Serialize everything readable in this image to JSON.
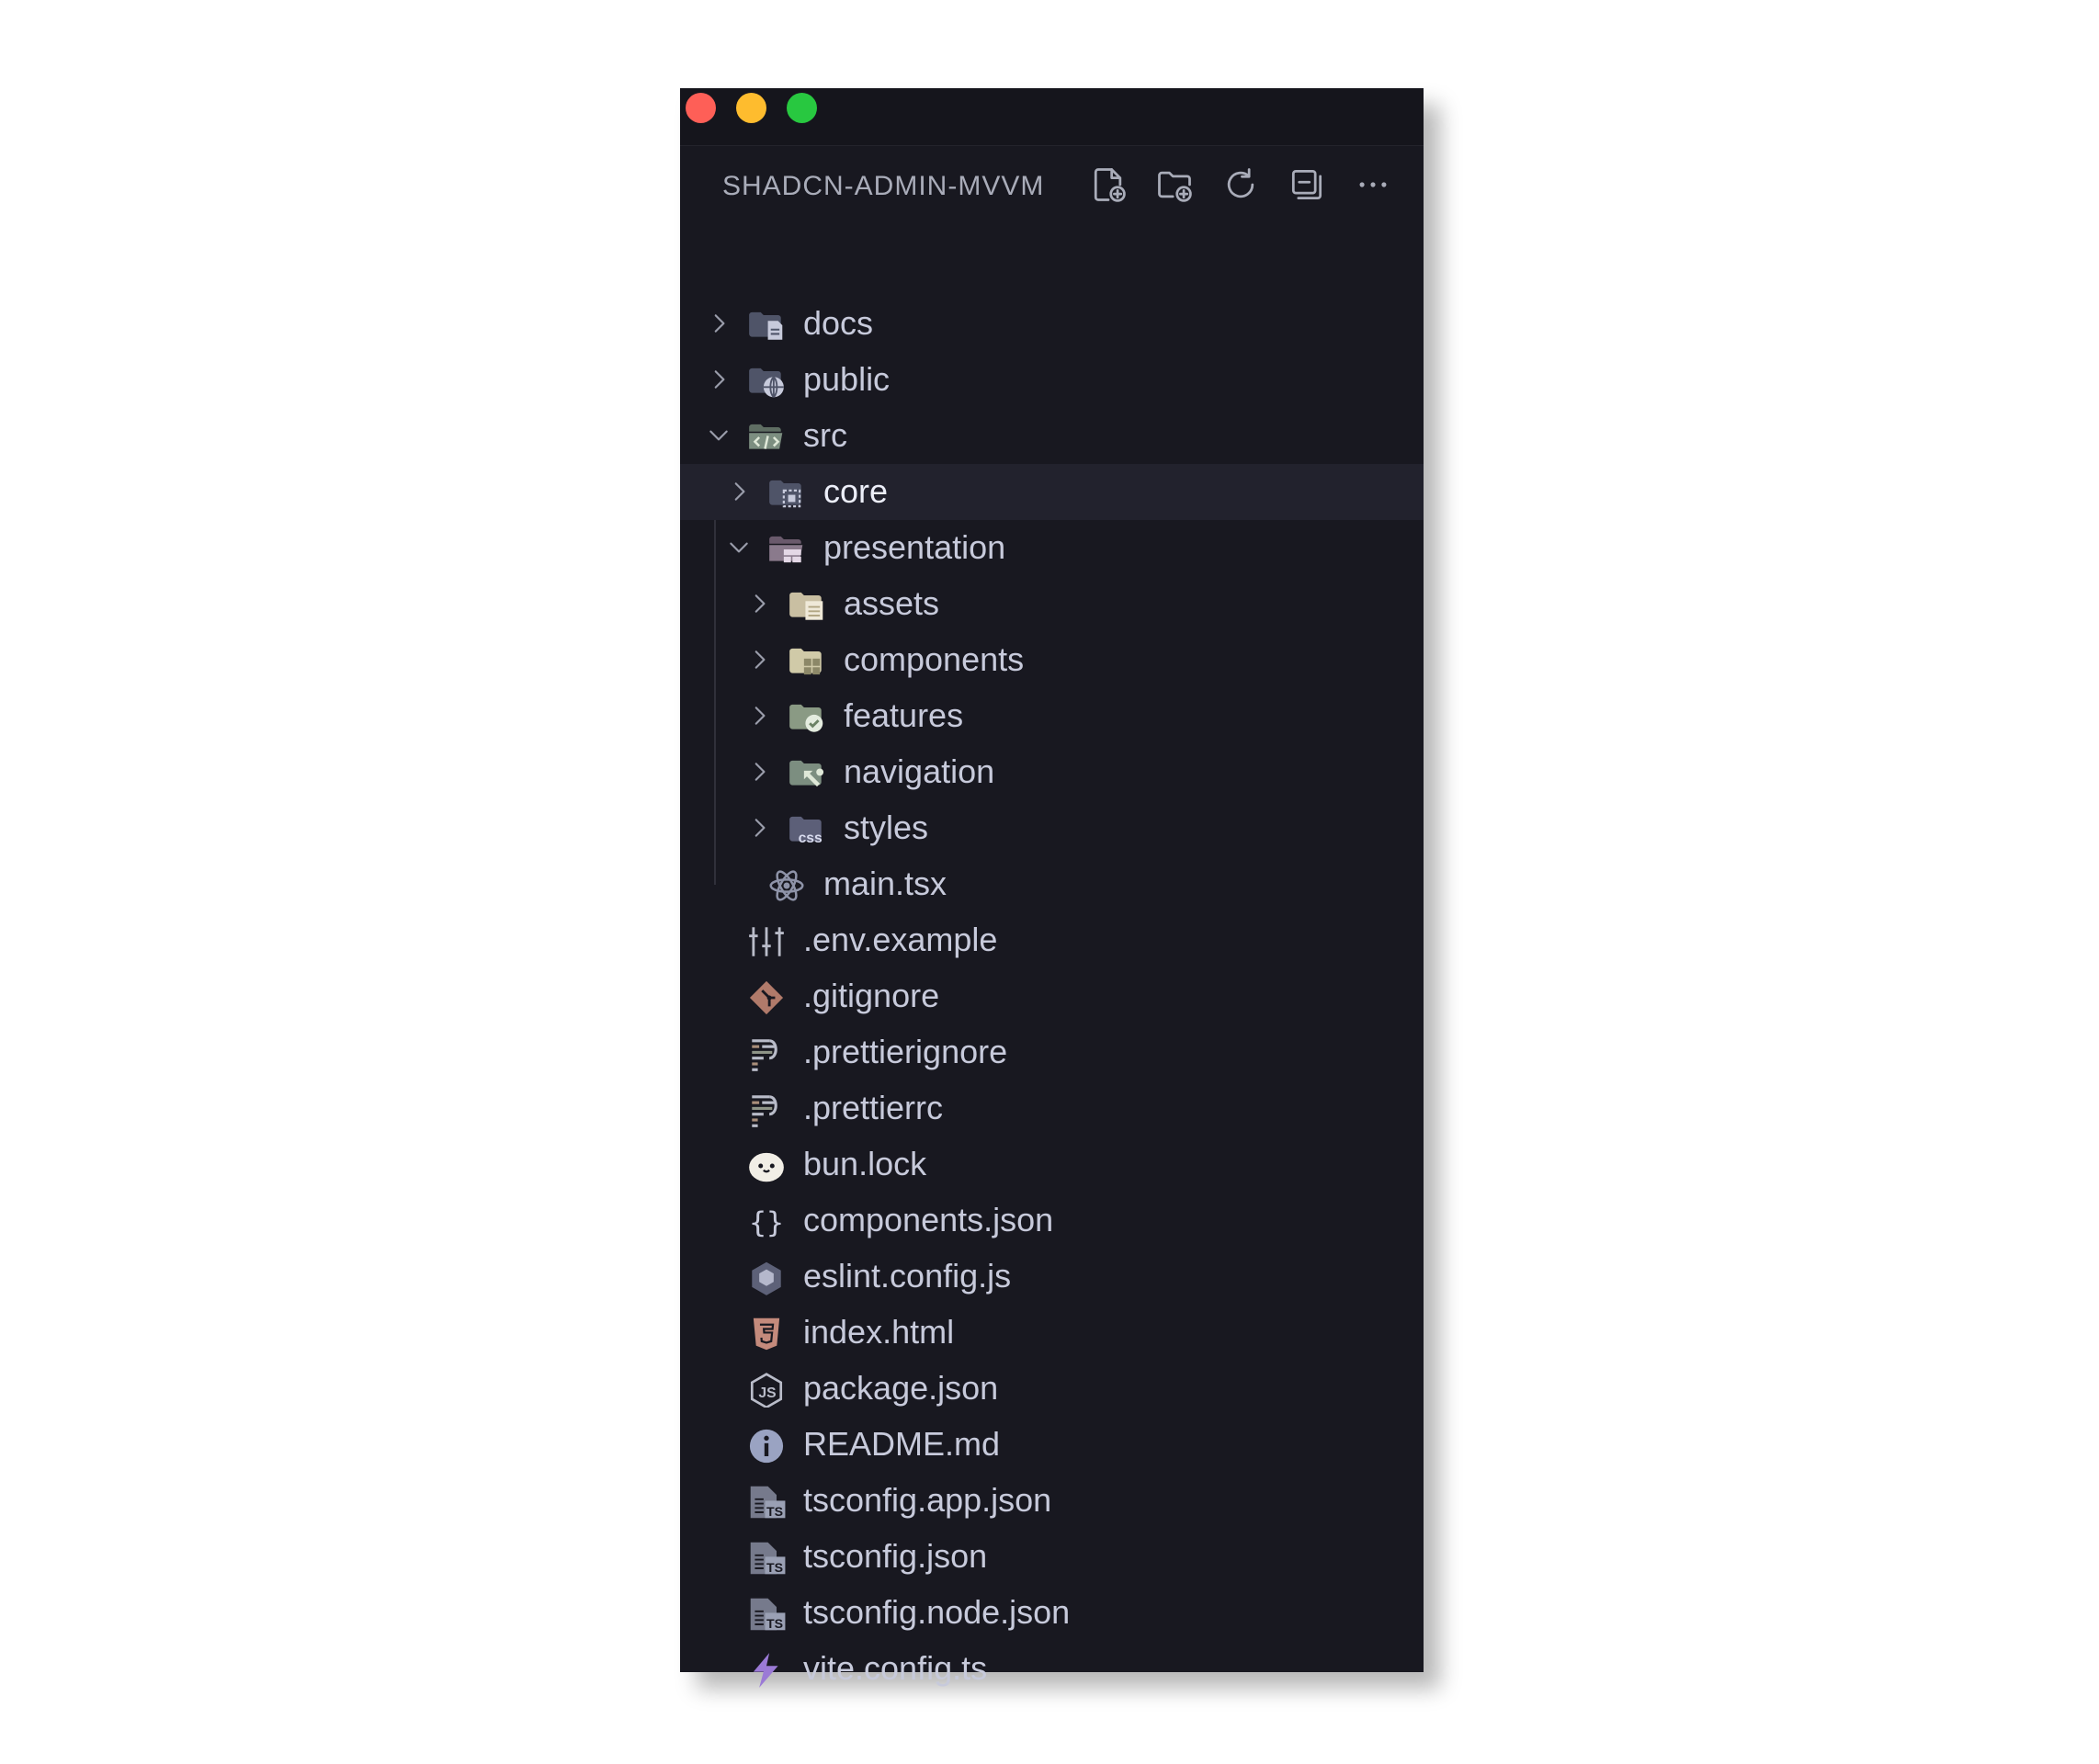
{
  "explorer": {
    "title": "SHADCN-ADMIN-MVVM"
  },
  "actions": [
    {
      "icon": "new-file-icon"
    },
    {
      "icon": "new-folder-icon"
    },
    {
      "icon": "refresh-icon"
    },
    {
      "icon": "collapse-all-icon"
    },
    {
      "icon": "more-icon"
    }
  ],
  "tree": [
    {
      "label": "docs",
      "level": 0,
      "kind": "folder",
      "expanded": false,
      "icon": "folder-docs-icon"
    },
    {
      "label": "public",
      "level": 0,
      "kind": "folder",
      "expanded": false,
      "icon": "folder-public-icon"
    },
    {
      "label": "src",
      "level": 0,
      "kind": "folder",
      "expanded": true,
      "icon": "folder-src-icon"
    },
    {
      "label": "core",
      "level": 1,
      "kind": "folder",
      "expanded": false,
      "selected": true,
      "icon": "folder-core-icon"
    },
    {
      "label": "presentation",
      "level": 1,
      "kind": "folder",
      "expanded": true,
      "icon": "folder-presentation-icon"
    },
    {
      "label": "assets",
      "level": 2,
      "kind": "folder",
      "expanded": false,
      "icon": "folder-assets-icon"
    },
    {
      "label": "components",
      "level": 2,
      "kind": "folder",
      "expanded": false,
      "icon": "folder-components-icon"
    },
    {
      "label": "features",
      "level": 2,
      "kind": "folder",
      "expanded": false,
      "icon": "folder-features-icon"
    },
    {
      "label": "navigation",
      "level": 2,
      "kind": "folder",
      "expanded": false,
      "icon": "folder-navigation-icon"
    },
    {
      "label": "styles",
      "level": 2,
      "kind": "folder",
      "expanded": false,
      "icon": "folder-css-icon"
    },
    {
      "label": "main.tsx",
      "level": 1,
      "kind": "file",
      "icon": "react-icon"
    },
    {
      "label": ".env.example",
      "level": 0,
      "kind": "file",
      "icon": "env-icon"
    },
    {
      "label": ".gitignore",
      "level": 0,
      "kind": "file",
      "icon": "git-icon"
    },
    {
      "label": ".prettierignore",
      "level": 0,
      "kind": "file",
      "icon": "prettier-icon"
    },
    {
      "label": ".prettierrc",
      "level": 0,
      "kind": "file",
      "icon": "prettier-icon"
    },
    {
      "label": "bun.lock",
      "level": 0,
      "kind": "file",
      "icon": "bun-icon"
    },
    {
      "label": "components.json",
      "level": 0,
      "kind": "file",
      "icon": "json-icon"
    },
    {
      "label": "eslint.config.js",
      "level": 0,
      "kind": "file",
      "icon": "eslint-icon"
    },
    {
      "label": "index.html",
      "level": 0,
      "kind": "file",
      "icon": "html-icon"
    },
    {
      "label": "package.json",
      "level": 0,
      "kind": "file",
      "icon": "nodejs-icon"
    },
    {
      "label": "README.md",
      "level": 0,
      "kind": "file",
      "icon": "info-icon"
    },
    {
      "label": "tsconfig.app.json",
      "level": 0,
      "kind": "file",
      "icon": "tsconfig-icon"
    },
    {
      "label": "tsconfig.json",
      "level": 0,
      "kind": "file",
      "icon": "tsconfig-icon"
    },
    {
      "label": "tsconfig.node.json",
      "level": 0,
      "kind": "file",
      "icon": "tsconfig-icon"
    },
    {
      "label": "vite.config.ts",
      "level": 0,
      "kind": "file",
      "icon": "vite-icon"
    }
  ],
  "colors": {
    "background": "#181820",
    "titlebar": "#15151c",
    "selection": "#22222d",
    "text": "#c7cadb",
    "header_text": "#a9acb9",
    "close": "#fe5f57",
    "minimize": "#febc2e",
    "maximize": "#28c840"
  }
}
